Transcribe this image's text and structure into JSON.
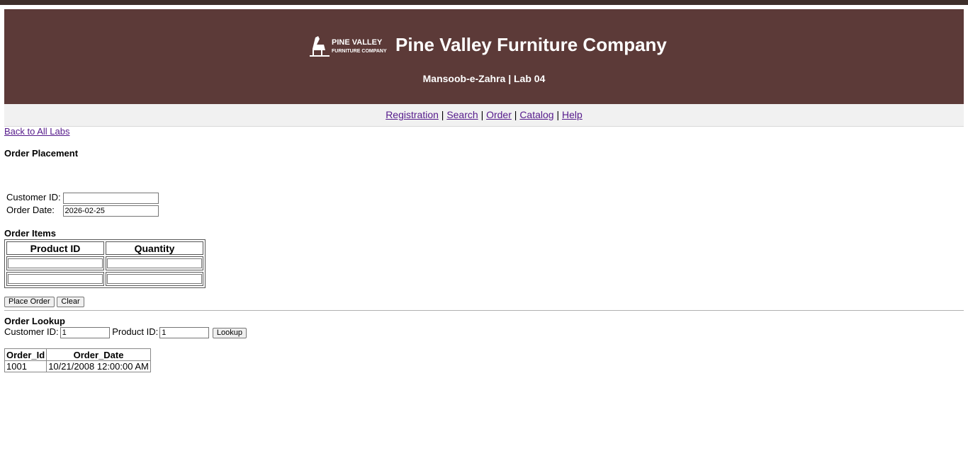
{
  "brand": {
    "logo_text_main": "PINE VALLEY",
    "logo_text_sub": "FURNITURE COMPANY",
    "title": "Pine Valley Furniture Company",
    "subtitle": "Mansoob-e-Zahra | Lab 04"
  },
  "nav": {
    "items": [
      {
        "label": "Registration"
      },
      {
        "label": "Search"
      },
      {
        "label": "Order"
      },
      {
        "label": "Catalog"
      },
      {
        "label": "Help"
      }
    ],
    "separator": "|"
  },
  "back_link": "Back to All Labs",
  "order_placement": {
    "heading": "Order Placement",
    "customer_id_label": "Customer ID:",
    "customer_id_value": "",
    "order_date_label": "Order Date:",
    "order_date_value": "2026-02-25"
  },
  "order_items": {
    "heading": "Order Items",
    "columns": [
      "Product ID",
      "Quantity"
    ],
    "rows": [
      {
        "product_id": "",
        "quantity": ""
      },
      {
        "product_id": "",
        "quantity": ""
      }
    ]
  },
  "actions": {
    "place_order": "Place Order",
    "clear": "Clear"
  },
  "order_lookup": {
    "heading": "Order Lookup",
    "customer_id_label": "Customer ID:",
    "customer_id_value": "1",
    "product_id_label": "Product ID:",
    "product_id_value": "1",
    "lookup_button": "Lookup"
  },
  "results": {
    "columns": [
      "Order_Id",
      "Order_Date"
    ],
    "rows": [
      {
        "order_id": "1001",
        "order_date": "10/21/2008 12:00:00 AM"
      }
    ]
  },
  "colors": {
    "banner": "#5c3a38",
    "top_strip": "#3e2f2b",
    "link": "#551a8b",
    "nav_bg": "#f1f1f1"
  }
}
